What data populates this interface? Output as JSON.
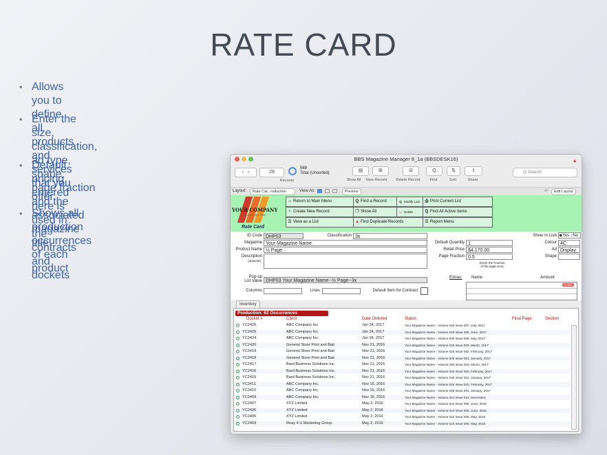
{
  "slide": {
    "title": "RATE CARD",
    "bullets": [
      "Allows you to define all products and services that you offer",
      "Enter the size, classification, ad type, shape,\npage fraction and the associated magazine title",
      "Default pricing entered here is\nused in the contracts and dockets",
      "Shows all production occurrences\nof each product"
    ],
    "bullet_glyph": "•"
  },
  "window": {
    "title": "BBS Magazine Manager 8_1a (BBSDESK16)",
    "record_current": "29",
    "record_total": "569",
    "record_total_label": "Total (Unsorted)",
    "records_label": "Records",
    "toolbar_labels": [
      "Show All",
      "New Record",
      "Delete Record",
      "Find",
      "Sort",
      "Share"
    ],
    "search_placeholder": "Q Search",
    "layout_label": "Layout:",
    "layout_value": "Rate Car...roduction",
    "view_as_label": "View As:",
    "preview_label": "Preview",
    "edit_layout_label": "Edit Layout",
    "aa_label": "A²"
  },
  "header": {
    "logo_text": "YOUR COMPANY",
    "logo_sub": "Logo Goes Here",
    "rate_card_label": "Rate Card",
    "buttons": [
      {
        "label": "Return to Main Menu",
        "icon": "home-icon"
      },
      {
        "label": "Find a Record",
        "icon": "magnifier-icon"
      },
      {
        "label": "Modify Last",
        "icon": "magnifier-icon"
      },
      {
        "label": "Print Current List",
        "icon": "printer-icon"
      },
      {
        "label": "Create New Record",
        "icon": "plus-icon"
      },
      {
        "label": "Show All",
        "icon": "copy-icon"
      },
      {
        "label": "Delete Record",
        "icon": "trash-icon"
      },
      {
        "label": "Find All Active Items",
        "icon": "magnifier-icon"
      },
      {
        "label": "View as a List",
        "icon": "list-icon"
      },
      {
        "label": "Find Duplicate Records",
        "icon": "warning-icon"
      },
      {
        "label": "Report Menu",
        "icon": "list-icon"
      }
    ]
  },
  "form": {
    "id_code_label": "ID Code",
    "id_code": "DHP03",
    "classification_label": "Classification",
    "classification": "3x",
    "magazine_label": "Magazine",
    "magazine": "Your Magazine Name",
    "product_name_label": "Product Name",
    "product_name": "½ Page",
    "description_label": "Description",
    "description_sub": "(optional)",
    "default_quantity_label": "Default Quantity",
    "default_quantity": "1",
    "retail_price_label": "Retail Price",
    "retail_price": "$4,170.00",
    "page_fraction_label": "Page Fraction",
    "page_fraction": "0.5",
    "page_fraction_hint": "(Enter the Fraction\nof the page size)",
    "show_in_lists_label": "Show In Lists",
    "show_yes": "Yes",
    "show_no": "No",
    "colour_label": "Colour",
    "colour": "4C",
    "ad_label": "Ad",
    "ad": "Display",
    "shape_label": "Shape",
    "popup_label": "Pop-up\nList Value",
    "popup_value": "DHP03  Your Magazine Name--½ Page--3x",
    "columns_label": "Columns",
    "lines_label": "Lines",
    "default_item_label": "Default Item for Contract",
    "extras_label": "Extras:",
    "name_label": "Name",
    "amount_label": "Amount",
    "delete_label": "Delete"
  },
  "inventory_tab": "Inventory",
  "production": {
    "badge": "Production: 62 Occurrences",
    "columns": [
      "Docket #",
      "Client",
      "Date Ordered",
      "Status",
      "Final Page",
      "Section"
    ],
    "rows": [
      [
        "YC2426",
        "ABC Company Inc.",
        "Jan 24, 2017",
        "Your Magazine Name - Volume 025 Issue 007, July, 2017"
      ],
      [
        "YC2425",
        "ABC Company Inc.",
        "Jan 24, 2017",
        "Your Magazine Name - Volume 025 Issue 006, June, 2017"
      ],
      [
        "YC2424",
        "ABC Company Inc.",
        "Jan 24, 2017",
        "Your Magazine Name - Volume 025 Issue 005, May, 2017"
      ],
      [
        "YC2420",
        "General Store Print and Bait",
        "Nov 21, 2016",
        "Your Magazine Name - Volume 025 Issue 003, March, 2017"
      ],
      [
        "YC2419",
        "General Store Print and Bait",
        "Nov 21, 2016",
        "Your Magazine Name - Volume 025 Issue 002, February, 2017"
      ],
      [
        "YC2418",
        "General Store Print and Bait",
        "Nov 21, 2016",
        "Your Magazine Name - Volume 025 Issue 001, January, 2017"
      ],
      [
        "YC2417",
        "Bard Business Solutions Inc.",
        "Nov 21, 2016",
        "Your Magazine Name - Volume 025 Issue 003, March, 2017"
      ],
      [
        "YC2416",
        "Bard Business Solutions Inc.",
        "Nov 21, 2016",
        "Your Magazine Name - Volume 025 Issue 002, February, 2017"
      ],
      [
        "YC2415",
        "Bard Business Solutions Inc.",
        "Nov 21, 2016",
        "Your Magazine Name - Volume 025 Issue 001, January, 2017"
      ],
      [
        "YC2411",
        "ABC Company Inc.",
        "Nov 16, 2016",
        "Your Magazine Name - Volume 025 Issue 002, February, 2017"
      ],
      [
        "YC2410",
        "ABC Company Inc.",
        "Nov 16, 2016",
        "Your Magazine Name - Volume 025 Issue 001, January, 2017"
      ],
      [
        "YC2409",
        "ABC Company Inc.",
        "Nov 16, 2016",
        "Your Magazine Name - Volume 024 Issue 012, December,"
      ],
      [
        "YC2407",
        "XYZ Limited",
        "May 2, 2016",
        "Your Magazine Name - Volume 024 Issue 006, June, 2016"
      ],
      [
        "YC2406",
        "XYZ Limited",
        "May 2, 2016",
        "Your Magazine Name - Volume 024 Issue 006, June, 2016"
      ],
      [
        "YC2405",
        "XYZ Limited",
        "May 2, 2016",
        "Your Magazine Name - Volume 024 Issue 005, May, 2016"
      ],
      [
        "YC2403",
        "Reay 4 U Marketing Group",
        "May 2, 2016",
        "Your Magazine Name - Volume 024 Issue 005, May, 2016"
      ]
    ]
  }
}
